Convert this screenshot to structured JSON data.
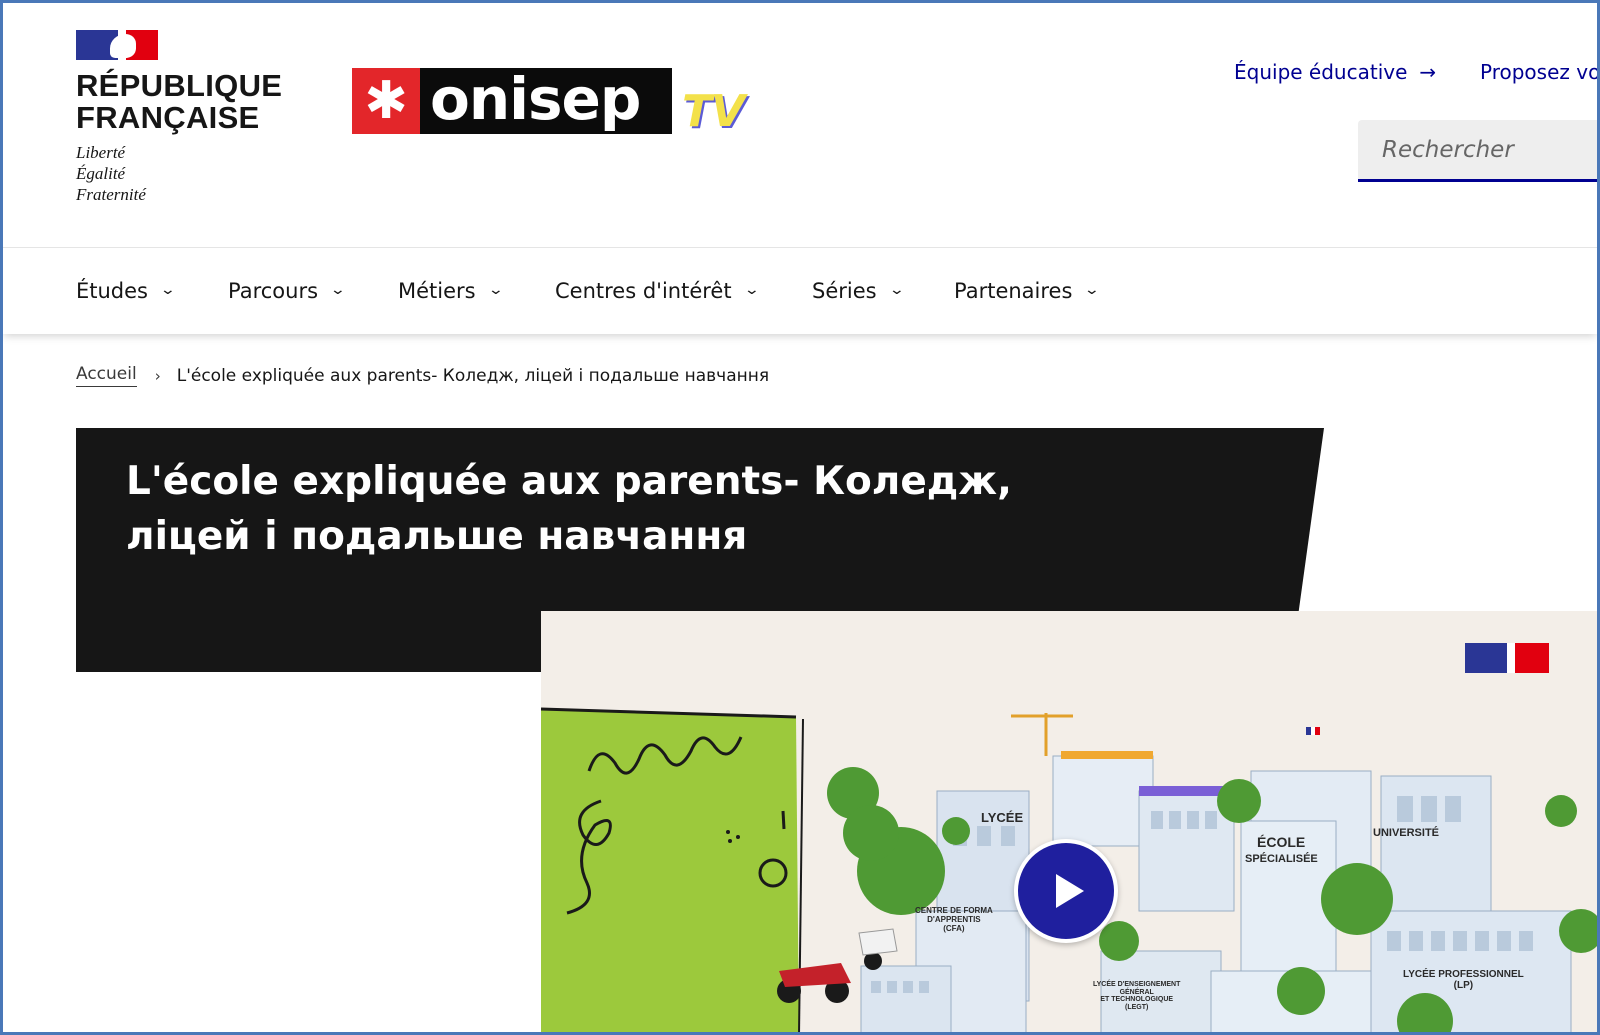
{
  "colors": {
    "accent_blue": "#000091",
    "banner_black": "#161616",
    "onisep_red": "#e3262a",
    "onisep_green": "#3c9b67",
    "tv_yellow": "#f3e14a",
    "play_button": "#1f1f9e"
  },
  "header": {
    "rf_title_line1": "RÉPUBLIQUE",
    "rf_title_line2": "FRANÇAISE",
    "rf_motto_1": "Liberté",
    "rf_motto_2": "Égalité",
    "rf_motto_3": "Fraternité",
    "logo_star": "✱",
    "logo_text": "onisep",
    "logo_tv": "TV",
    "link_team": "Équipe éducative",
    "link_team_icon": "arrow-right-icon",
    "link_propose": "Proposez vo",
    "search_placeholder": "Rechercher"
  },
  "nav": {
    "items": [
      {
        "label": "Études"
      },
      {
        "label": "Parcours"
      },
      {
        "label": "Métiers"
      },
      {
        "label": "Centres d'intérêt"
      },
      {
        "label": "Séries"
      },
      {
        "label": "Partenaires"
      }
    ]
  },
  "breadcrumb": {
    "home": "Accueil",
    "separator": "›",
    "current": "L'école expliquée aux parents- Коледж, ліцей і подальше навчання"
  },
  "page": {
    "title": "L'école expliquée aux parents- Коледж, ліцей і подальше навчання"
  },
  "video": {
    "labels": {
      "lycee": "LYCÉE",
      "ecole": "ÉCOLE",
      "specialisee": "SPÉCIALISÉE",
      "universite": "UNIVERSITÉ",
      "cfa_1": "CENTRE DE FORMA",
      "cfa_2": "D'APPRENTIS",
      "cfa_3": "(CFA)",
      "legt_1": "LYCÉE D'ENSEIGNEMENT",
      "legt_2": "GÉNÉRAL",
      "legt_3": "ET TECHNOLOGIQUE",
      "legt_4": "(LEGT)",
      "lp_1": "LYCÉE PROFESSIONNEL",
      "lp_2": "(LP)"
    }
  }
}
